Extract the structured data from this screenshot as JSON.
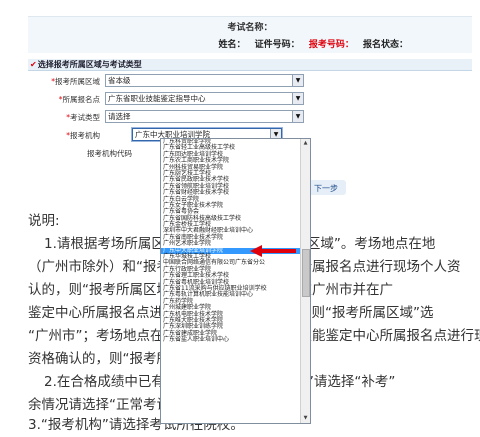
{
  "header": {
    "title": "考试名称：",
    "name_label": "姓名：",
    "id_label": "证件号码：",
    "exam_no_label": "报考号码：",
    "status_label": "报名状态："
  },
  "section": {
    "title": "选择报考所属区域与考试类型"
  },
  "form": {
    "region_label": "报考所属区域",
    "region_value": "省本级",
    "site_label": "所属报名点",
    "site_value": "广东省职业技能鉴定指导中心",
    "type_label": "考试类型",
    "type_value": "请选择",
    "org_label": "报考机构",
    "org_value": "广东中大职业培训学院",
    "org_code_label": "报考机构代码"
  },
  "next_label": "下一步",
  "dropdown_items": [
    "广东科贸职业学院",
    "广东省轻工业高级技工学校",
    "广东回达职业培训学校",
    "广东农工商职业技术学院",
    "广州科技贸易职业学院",
    "广东厨艺技工学校",
    "广东省民政职业技术学校",
    "广东省领航职业培训学校",
    "广东省财经职业技术学校",
    "广东白云学院",
    "广东女子职业技术学院",
    "广东省粤协会",
    "广东省国防科技高级技工学校",
    "广东金桥技工学校",
    "深圳市中大君融财经职业培训中心",
    "广东省南职业技术学院",
    "广州艺术职业学院",
    "广东中大职业培训学院",
    "广东华城技工学校",
    "中国联合网络通信有限公司广东省分公",
    "广东行政职业学院",
    "广东省理工职业技术学校",
    "广东省粤机职业培训学校",
    "广东省11流采购与供应链职业培训学校",
    "广东粤轨计算机职业技能培训中心",
    "广东药学院",
    "广州城建职业学院",
    "广东机电职业技术学院",
    "广东唯大职业技术学院",
    "广东深圳职业训练学院",
    "广东省建成职业学院",
    "广东省盐人职业培训中心"
  ],
  "selected_index": 17,
  "explanation": {
    "heading": "说明:",
    "lines": [
      "1.请根据考场所属区域，正确选择“报考所属区域”。考场地点在地",
      "（广州市除外）和“报考所属区域”所在地中心所属报名点进行现场个人资",
      "认的，则“报考所属区域”选择在地；考场地点在广州市并在广",
      "鉴定中心所属报名点进行现场个人资格确认的，则“报考所属区域”选",
      "“广州市”；考场地点在广州市并在广东省职业技能鉴定中心所属报名点进行现",
      "资格确认的，则“报考所属区域”选择“省本级”。",
      "2.在合格成绩中已有科目成绩，则“考试类型”请选择“补考”",
      "余情况请选择“正常考试”。",
      "3.“报考机构”请选择考试所在院校。"
    ]
  },
  "colors": {
    "accent_red": "#e0000c",
    "highlight": "#3399ff",
    "header_bg": "#f2f7fb"
  }
}
